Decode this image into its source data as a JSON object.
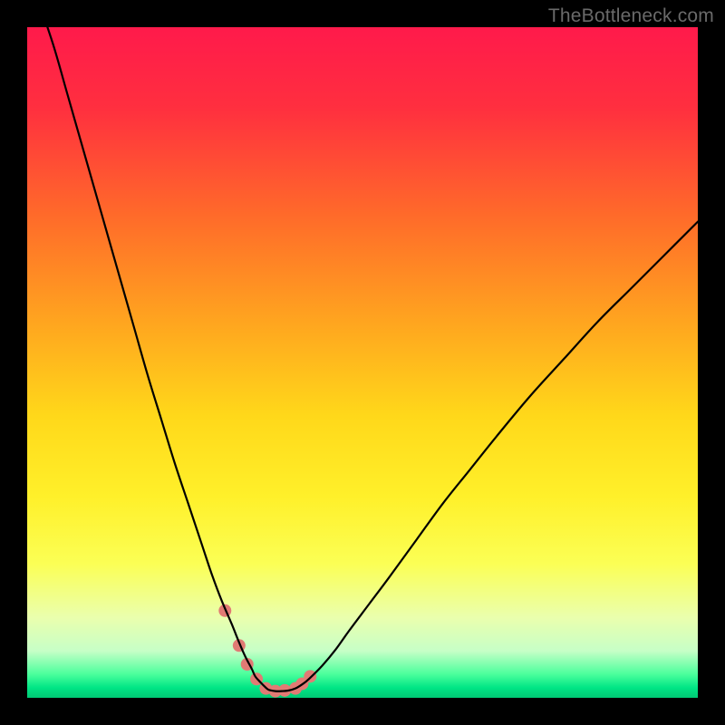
{
  "watermark": "TheBottleneck.com",
  "chart_data": {
    "type": "line",
    "title": "",
    "xlabel": "",
    "ylabel": "",
    "xlim": [
      0,
      100
    ],
    "ylim": [
      0,
      100
    ],
    "grid": false,
    "legend": false,
    "background_gradient_stops": [
      {
        "offset": 0.0,
        "color": "#ff1a4b"
      },
      {
        "offset": 0.12,
        "color": "#ff2f3f"
      },
      {
        "offset": 0.28,
        "color": "#ff6a2a"
      },
      {
        "offset": 0.44,
        "color": "#ffa51f"
      },
      {
        "offset": 0.58,
        "color": "#ffd81a"
      },
      {
        "offset": 0.7,
        "color": "#fff02a"
      },
      {
        "offset": 0.8,
        "color": "#fbff55"
      },
      {
        "offset": 0.88,
        "color": "#eaffad"
      },
      {
        "offset": 0.93,
        "color": "#c7ffc7"
      },
      {
        "offset": 0.965,
        "color": "#4aff9c"
      },
      {
        "offset": 0.985,
        "color": "#00e585"
      },
      {
        "offset": 1.0,
        "color": "#00c975"
      }
    ],
    "series": [
      {
        "name": "bottleneck-curve",
        "stroke": "#000000",
        "stroke_width": 2.2,
        "x": [
          2,
          4,
          6,
          8,
          10,
          12,
          14,
          16,
          18,
          20,
          22,
          24,
          26,
          27.5,
          29,
          30.5,
          31.5,
          32.5,
          33.5,
          34,
          34.8,
          35.5,
          36,
          37,
          38,
          39,
          40,
          41,
          42,
          44,
          46,
          48,
          51,
          54,
          58,
          62,
          66,
          70,
          75,
          80,
          85,
          90,
          95,
          100
        ],
        "values": [
          103,
          97,
          90,
          83,
          76,
          69,
          62,
          55,
          48,
          41.5,
          35,
          29,
          23,
          18.5,
          14.5,
          11,
          8.5,
          6.2,
          4.3,
          3.2,
          2.3,
          1.6,
          1.2,
          1.0,
          1.0,
          1.1,
          1.4,
          2.0,
          2.8,
          4.8,
          7.2,
          10,
          14,
          18,
          23.5,
          29,
          34,
          39,
          45,
          50.5,
          56,
          61,
          66,
          71
        ]
      }
    ],
    "markers": {
      "name": "highlight-dots",
      "color": "#e17a74",
      "radius_px": 7,
      "x": [
        29.5,
        31.6,
        32.8,
        34.2,
        35.6,
        37.0,
        38.4,
        40.0,
        41.0,
        42.2
      ],
      "values": [
        13.0,
        7.8,
        5.0,
        2.8,
        1.4,
        1.0,
        1.1,
        1.4,
        2.1,
        3.2
      ]
    }
  }
}
